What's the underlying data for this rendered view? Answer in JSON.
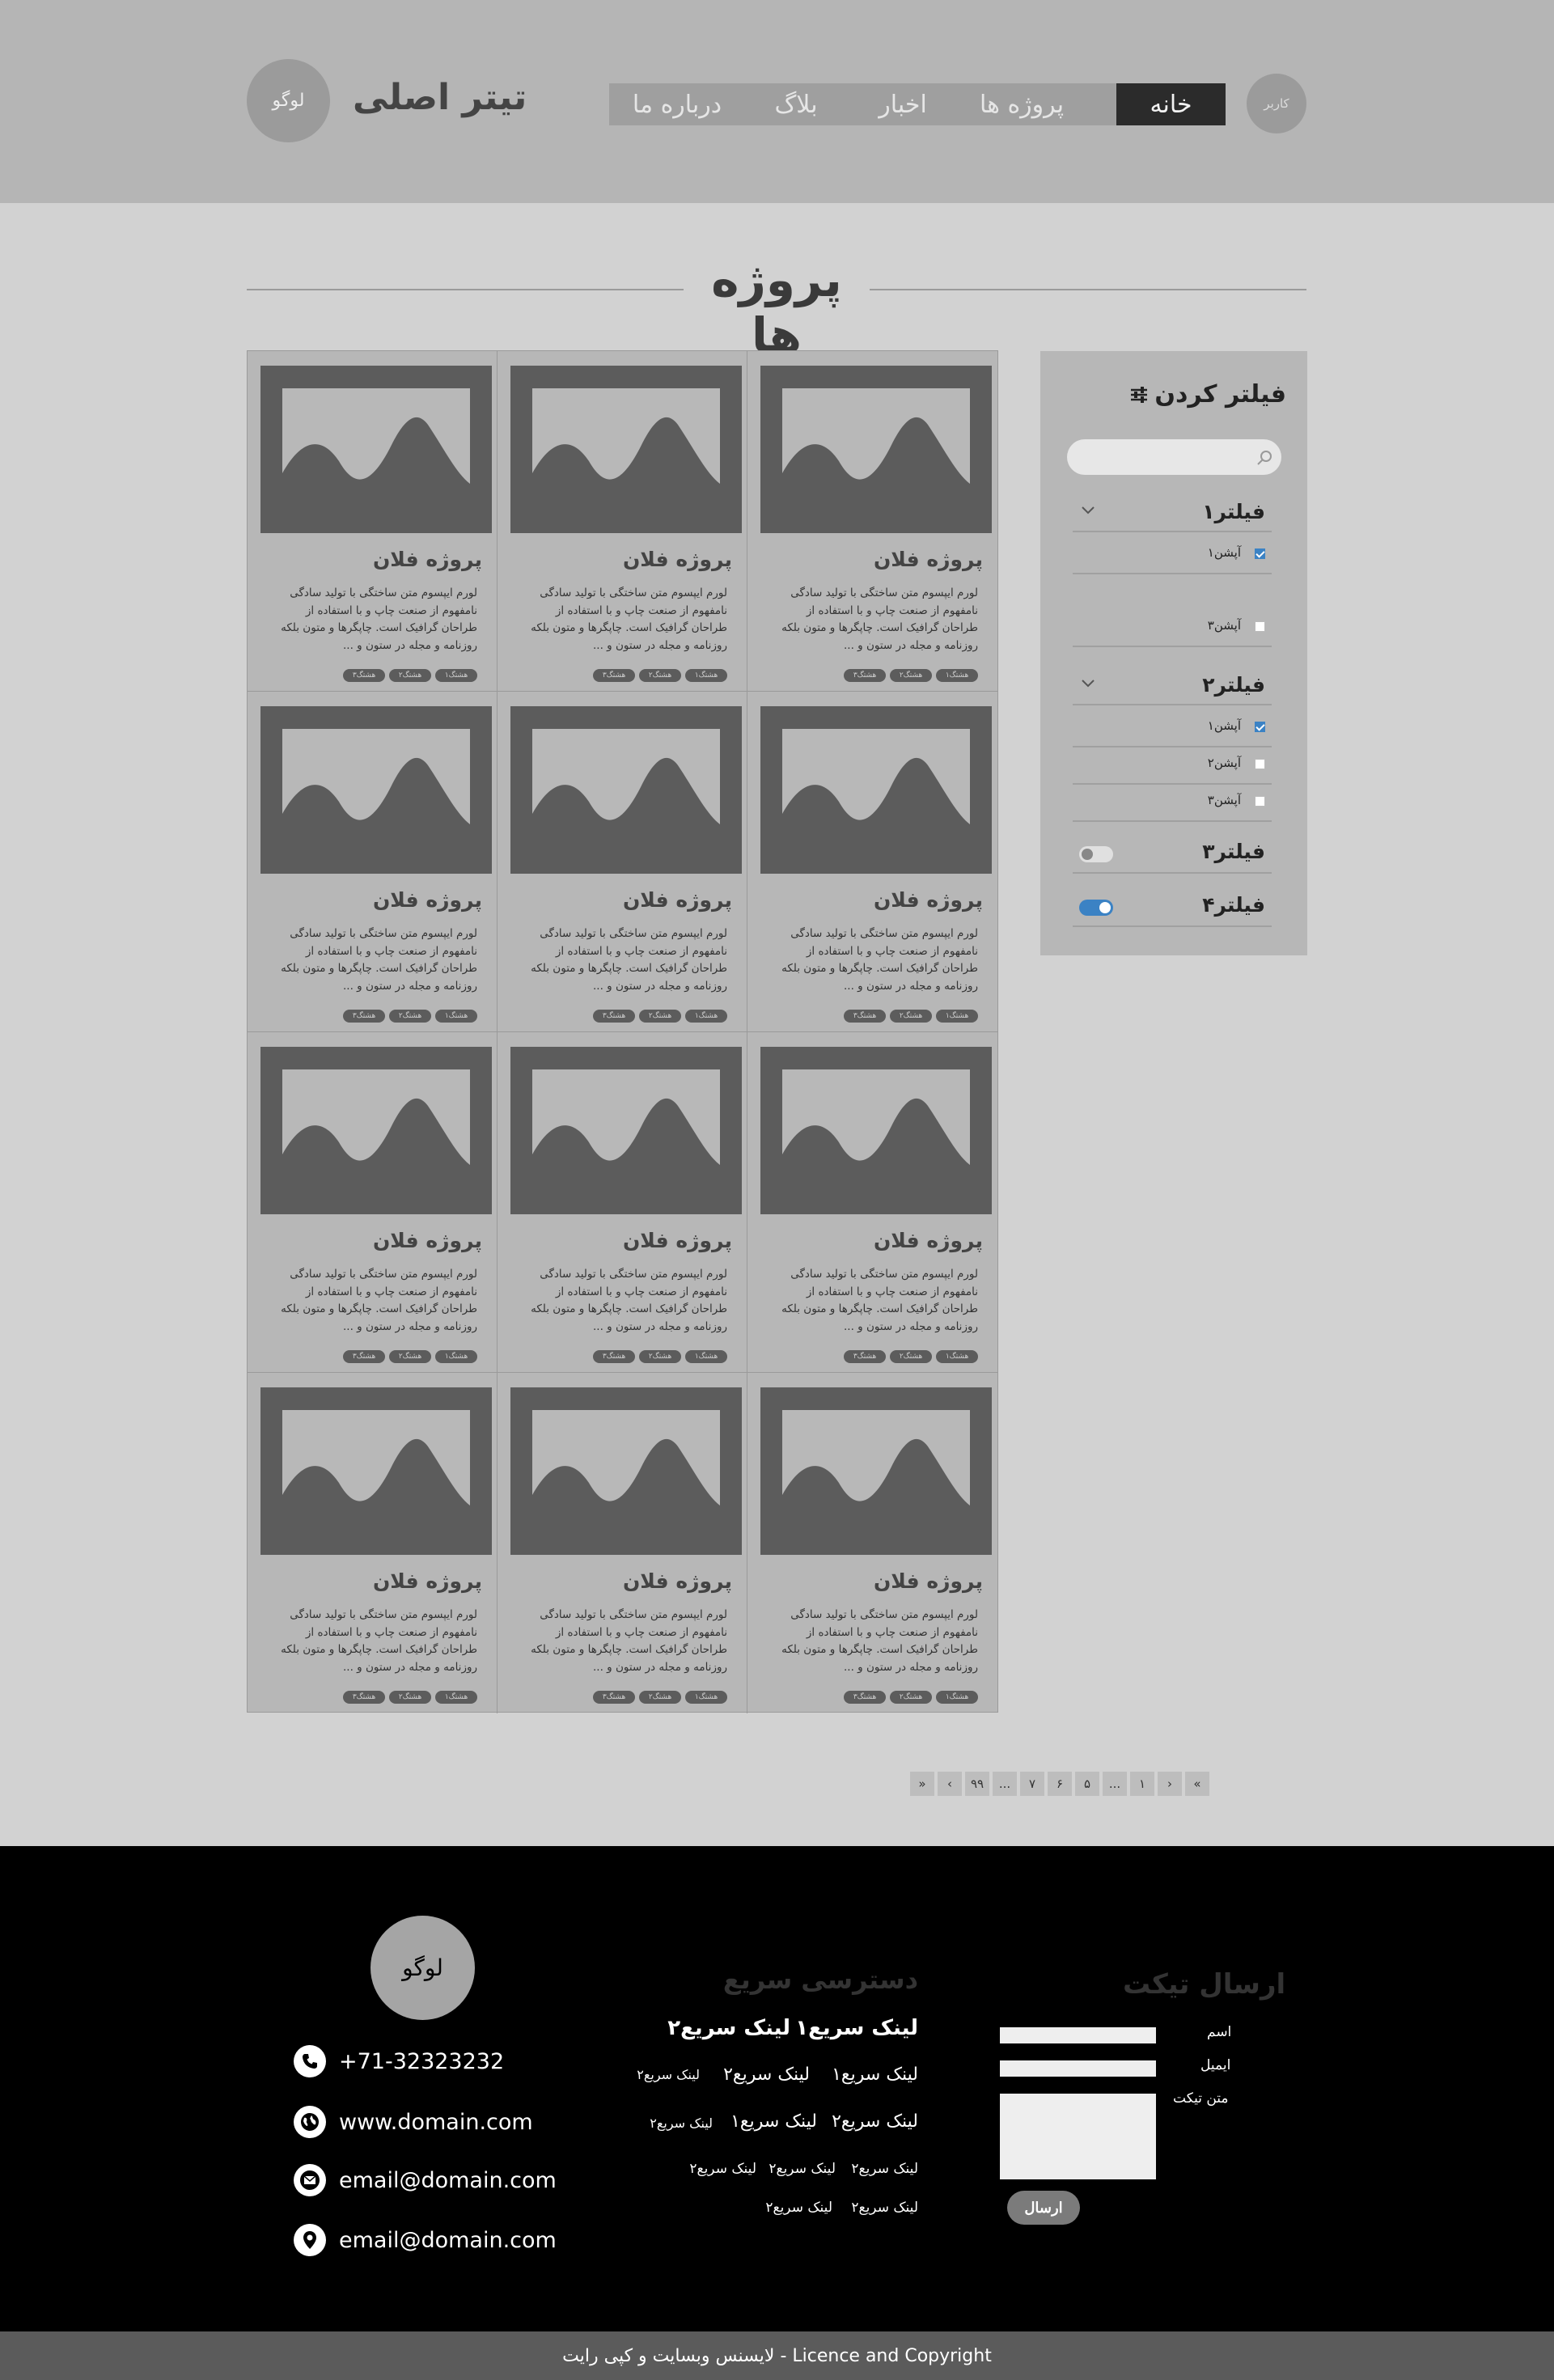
{
  "header": {
    "logo": "لوگو",
    "title": "تیتر اصلی",
    "nav": [
      "خانه",
      "پروژه ها",
      "اخبار",
      "بلاگ",
      "درباره ما"
    ],
    "active_nav": "خانه",
    "user": "کاربر"
  },
  "page": {
    "title": "پروژه ها"
  },
  "cards": [
    {
      "title": "پروژه فلان",
      "desc": "لورم ایپسوم متن ساختگی با تولید سادگی نامفهوم از صنعت چاپ و با استفاده از طراحان گرافیک است. چاپگرها و متون بلکه روزنامه و مجله در ستون و ...",
      "tags": [
        "هشتگ۱",
        "هشتگ۲",
        "هشتگ۳"
      ]
    }
  ],
  "filter": {
    "title": "فیلتر کردن",
    "search_placeholder": "",
    "f1": {
      "label": "فیلتر۱",
      "options": [
        {
          "label": "آپشن۱",
          "checked": true
        },
        {
          "label": "آپشن۳",
          "checked": false
        }
      ]
    },
    "f2": {
      "label": "فیلتر۲",
      "options": [
        {
          "label": "آپشن۱",
          "checked": true
        },
        {
          "label": "آپشن۲",
          "checked": false
        },
        {
          "label": "آپشن۳",
          "checked": false
        }
      ]
    },
    "f3": {
      "label": "فیلتر۳",
      "on": false
    },
    "f4": {
      "label": "فیلتر۴",
      "on": true
    }
  },
  "pagination": [
    "»",
    "‹",
    "۹۹",
    "...",
    "۷",
    "۶",
    "۵",
    "...",
    "۱",
    "›",
    "«"
  ],
  "footer": {
    "logo": "لوگو",
    "phone": "+71-32323232",
    "website": "www.domain.com",
    "email": "email@domain.com",
    "address": "email@domain.com",
    "quick_title": "دسترسی سریع",
    "link1": "لینک سریع۱",
    "link2": "لینک سریع۲",
    "ticket_title": "ارسال تیکت",
    "name_label": "اسم",
    "email_label": "ایمیل",
    "text_label": "متن تیکت",
    "send": "ارسال",
    "copyright": "لایسنس وبسایت و کپی رایت - Licence and Copyright"
  },
  "colors": {
    "header_bg": "#b5b5b5",
    "page_bg": "#d2d2d2",
    "active_nav": "#2b2b2b",
    "accent": "#3b82c4",
    "footer_bg": "#000000",
    "copyright_bg": "#5b5b5b"
  }
}
